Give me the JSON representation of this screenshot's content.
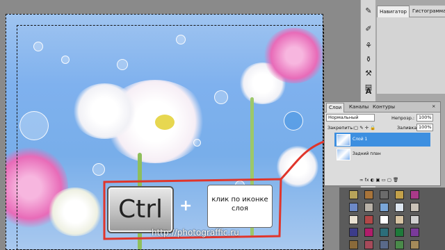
{
  "navigator_tabs": {
    "navigator": "Навигатор",
    "histogram": "Гистограмма"
  },
  "layers_panel": {
    "tabs": [
      "Слои",
      "Каналы",
      "Контуры"
    ],
    "blend_mode": "Нормальный",
    "opacity_label": "Непрозр.:",
    "opacity_value": "100%",
    "lock_label": "Закрепить:",
    "fill_label": "Заливка:",
    "fill_value": "100%",
    "layers": [
      {
        "name": "Слой 1",
        "selected": true
      },
      {
        "name": "Задний план",
        "selected": false
      }
    ]
  },
  "tutorial": {
    "key_label": "Ctrl",
    "plus": "+",
    "hint": "клик по иконке слоя",
    "url": "http://photograffic.ru"
  },
  "tools": [
    "pencil-tool",
    "brush-tool",
    "stamp-tool",
    "history-brush-tool",
    "eraser-tool",
    "gradient-tool",
    "text-tool"
  ],
  "colors": {
    "accent": "#e0352b",
    "selection": "#3d8fe0"
  }
}
